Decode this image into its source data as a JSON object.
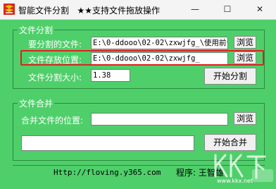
{
  "window": {
    "title": "智能文件分割   ★★支持文件拖放操作",
    "min_glyph": "—",
    "max_glyph": "☐",
    "close_glyph": "✕"
  },
  "split": {
    "group_title": "文件分割",
    "file_label": "要分割的文件:",
    "file_value": "E:\\0-ddooo\\02-02\\zxwjfg_\\使用前讲",
    "browse_file": "浏览",
    "save_label": "文件存放位置:",
    "save_value": "E:\\0-ddooo\\02-02\\zxwjfg_",
    "browse_save": "浏览",
    "size_label": "文件分割大小:",
    "size_value": "1.38",
    "start_button": "开始分割"
  },
  "merge": {
    "group_title": "文件合并",
    "location_label": "合并文件的位置:",
    "location_value": "",
    "browse": "浏览",
    "path_value": "",
    "start_button": "开始合并"
  },
  "status": {
    "url": "Http://floving.y365.com",
    "author": "程序: 王智雄"
  },
  "watermark": {
    "text": "KK下载",
    "url": "www.kkx.net"
  }
}
